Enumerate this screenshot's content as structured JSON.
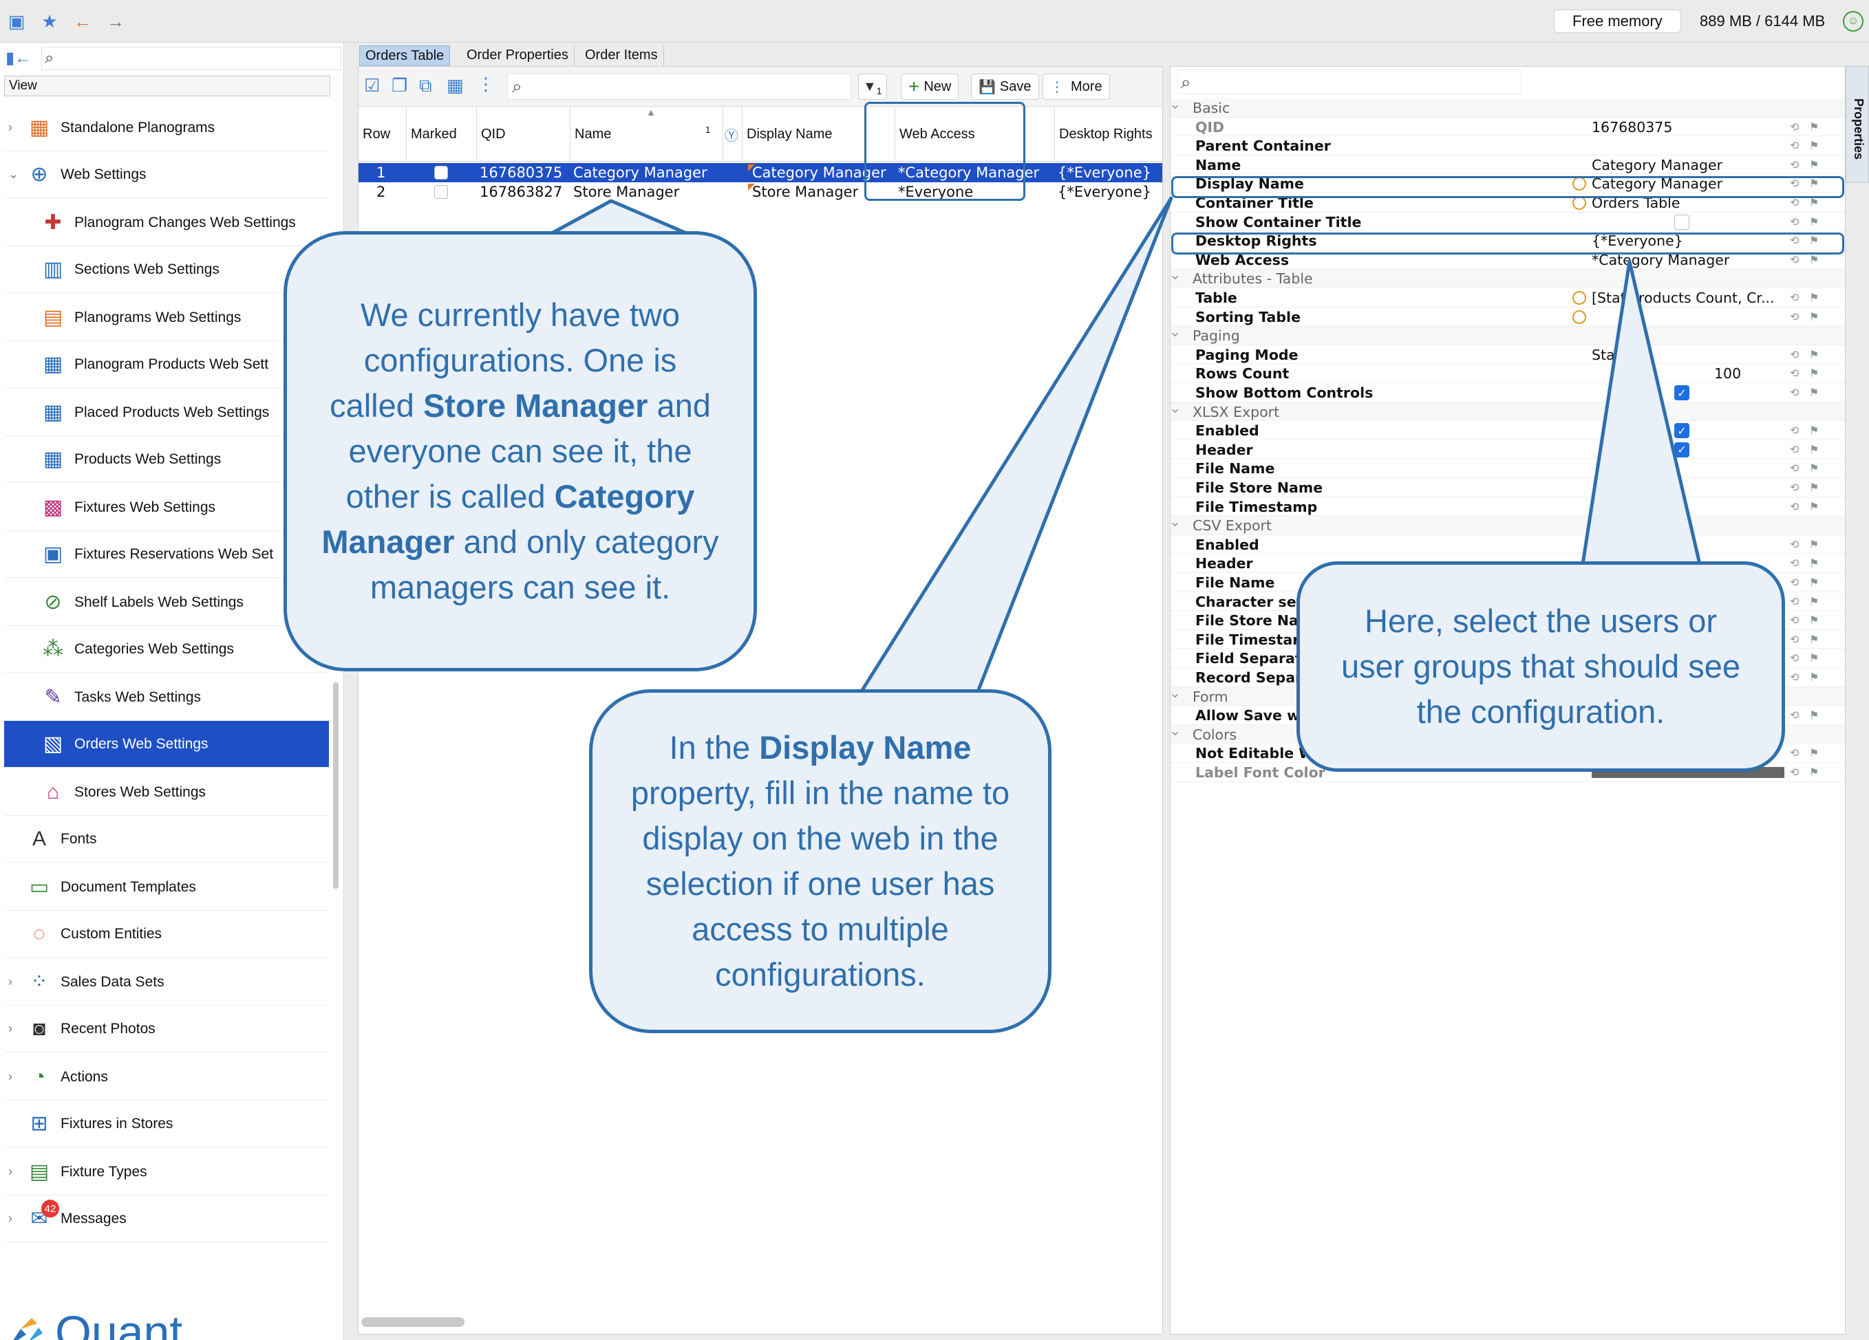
{
  "topbar": {
    "free_memory_label": "Free memory",
    "memory_value": "889 MB / 6144 MB"
  },
  "left": {
    "view_label": "View",
    "items": [
      {
        "label": "Standalone Planograms",
        "icon": "planogram-icon"
      },
      {
        "label": "Web Settings",
        "icon": "web-settings-icon"
      },
      {
        "label": "Planogram Changes Web Settings",
        "icon": "planogram-changes-icon"
      },
      {
        "label": "Sections Web Settings",
        "icon": "sections-icon"
      },
      {
        "label": "Planograms Web Settings",
        "icon": "planograms-icon"
      },
      {
        "label": "Planogram Products Web Sett",
        "icon": "planogram-products-icon"
      },
      {
        "label": "Placed Products Web Settings",
        "icon": "placed-products-icon"
      },
      {
        "label": "Products Web Settings",
        "icon": "products-icon"
      },
      {
        "label": "Fixtures Web Settings",
        "icon": "fixtures-icon"
      },
      {
        "label": "Fixtures Reservations Web Set",
        "icon": "calendar-icon"
      },
      {
        "label": "Shelf Labels Web Settings",
        "icon": "shelf-labels-icon"
      },
      {
        "label": "Categories Web Settings",
        "icon": "categories-icon"
      },
      {
        "label": "Tasks Web Settings",
        "icon": "tasks-icon"
      },
      {
        "label": "Orders Web Settings",
        "icon": "orders-icon"
      },
      {
        "label": "Stores Web Settings",
        "icon": "stores-icon"
      },
      {
        "label": "Fonts",
        "icon": "fonts-icon"
      },
      {
        "label": "Document Templates",
        "icon": "document-templates-icon"
      },
      {
        "label": "Custom Entities",
        "icon": "custom-entities-icon"
      },
      {
        "label": "Sales Data Sets",
        "icon": "sales-data-icon"
      },
      {
        "label": "Recent Photos",
        "icon": "camera-icon"
      },
      {
        "label": "Actions",
        "icon": "actions-icon"
      },
      {
        "label": "Fixtures in Stores",
        "icon": "fixtures-in-stores-icon"
      },
      {
        "label": "Fixture Types",
        "icon": "fixture-types-icon"
      },
      {
        "label": "Messages",
        "icon": "messages-icon",
        "badge": "42"
      }
    ],
    "logo_text": "Quant"
  },
  "tabs": [
    "Orders Table",
    "Order Properties",
    "Order Items"
  ],
  "toolbar": {
    "new_label": "New",
    "save_label": "Save",
    "more_label": "More",
    "filter_count": "1"
  },
  "table": {
    "columns": [
      "Row",
      "Marked",
      "QID",
      "Name",
      "Display Name",
      "Web Access",
      "Desktop Rights"
    ],
    "sort_indicator": "1",
    "rows": [
      {
        "row": "1",
        "qid": "167680375",
        "name": "Category Manager",
        "display_name": "Category Manager",
        "web_access": "*Category Manager",
        "desktop_rights": "{*Everyone}"
      },
      {
        "row": "2",
        "qid": "167863827",
        "name": "Store Manager",
        "display_name": "Store Manager",
        "web_access": "*Everyone",
        "desktop_rights": "{*Everyone}"
      }
    ]
  },
  "properties": {
    "tab_label": "Properties",
    "rows": [
      {
        "kind": "section",
        "label": "Basic"
      },
      {
        "kind": "prop",
        "label": "QID",
        "value": "167680375",
        "gray": true
      },
      {
        "kind": "prop",
        "label": "Parent Container",
        "value": ""
      },
      {
        "kind": "prop",
        "label": "Name",
        "value": "Category Manager"
      },
      {
        "kind": "prop",
        "label": "Display Name",
        "value": "Category Manager",
        "marker": true
      },
      {
        "kind": "prop",
        "label": "Container Title",
        "value": "Orders Table",
        "marker": true
      },
      {
        "kind": "prop",
        "label": "Show Container Title",
        "value": "",
        "check": "off"
      },
      {
        "kind": "prop",
        "label": "Desktop Rights",
        "value": "{*Everyone}"
      },
      {
        "kind": "prop",
        "label": "Web Access",
        "value": "*Category Manager"
      },
      {
        "kind": "section",
        "label": "Attributes - Table"
      },
      {
        "kind": "prop",
        "label": "Table",
        "value": "[Stat  Products Count, Cr...",
        "marker": true
      },
      {
        "kind": "prop",
        "label": "Sorting Table",
        "value": "",
        "marker": true
      },
      {
        "kind": "section",
        "label": "Paging"
      },
      {
        "kind": "prop",
        "label": "Paging Mode",
        "value": "Sta"
      },
      {
        "kind": "prop",
        "label": "Rows Count",
        "value": "100",
        "right": true
      },
      {
        "kind": "prop",
        "label": "Show Bottom Controls",
        "value": "",
        "check": "on"
      },
      {
        "kind": "section",
        "label": "XLSX Export"
      },
      {
        "kind": "prop",
        "label": "Enabled",
        "value": "",
        "check": "on"
      },
      {
        "kind": "prop",
        "label": "Header",
        "value": "",
        "check": "on"
      },
      {
        "kind": "prop",
        "label": "File Name",
        "value": ""
      },
      {
        "kind": "prop",
        "label": "File Store Name",
        "value": ""
      },
      {
        "kind": "prop",
        "label": "File Timestamp",
        "value": ""
      },
      {
        "kind": "section",
        "label": "CSV Export"
      },
      {
        "kind": "prop",
        "label": "Enabled",
        "value": ""
      },
      {
        "kind": "prop",
        "label": "Header",
        "value": ""
      },
      {
        "kind": "prop",
        "label": "File Name",
        "value": ""
      },
      {
        "kind": "prop",
        "label": "Character set",
        "value": ""
      },
      {
        "kind": "prop",
        "label": "File Store Nam",
        "value": ""
      },
      {
        "kind": "prop",
        "label": "File Timestam",
        "value": ""
      },
      {
        "kind": "prop",
        "label": "Field Separato",
        "value": ""
      },
      {
        "kind": "prop",
        "label": "Record Separa",
        "value": ""
      },
      {
        "kind": "section",
        "label": "Form"
      },
      {
        "kind": "prop",
        "label": "Allow Save wi",
        "value": ""
      },
      {
        "kind": "section",
        "label": "Colors"
      },
      {
        "kind": "prop",
        "label": "Not Editable W",
        "value": ""
      },
      {
        "kind": "prop",
        "label": "Label Font Color",
        "value": "",
        "gray": true
      }
    ]
  },
  "callouts": {
    "c1": {
      "t1": "We currently have two configurations. One is called ",
      "b1": "Store Manager",
      "t2": " and everyone can see it, the other is called ",
      "b2": "Category Manager",
      "t3": " and only category managers can see it."
    },
    "c2": {
      "t1": "In the ",
      "b1": "Display Name",
      "t2": " property, fill in the name to display on the web in the selection if one user has access to multiple configurations."
    },
    "c3": {
      "t1": "Here, select the users or user groups that should see the configuration."
    }
  },
  "colors": {
    "accent": "#1f4fc4",
    "callout": "#2f6fad"
  }
}
